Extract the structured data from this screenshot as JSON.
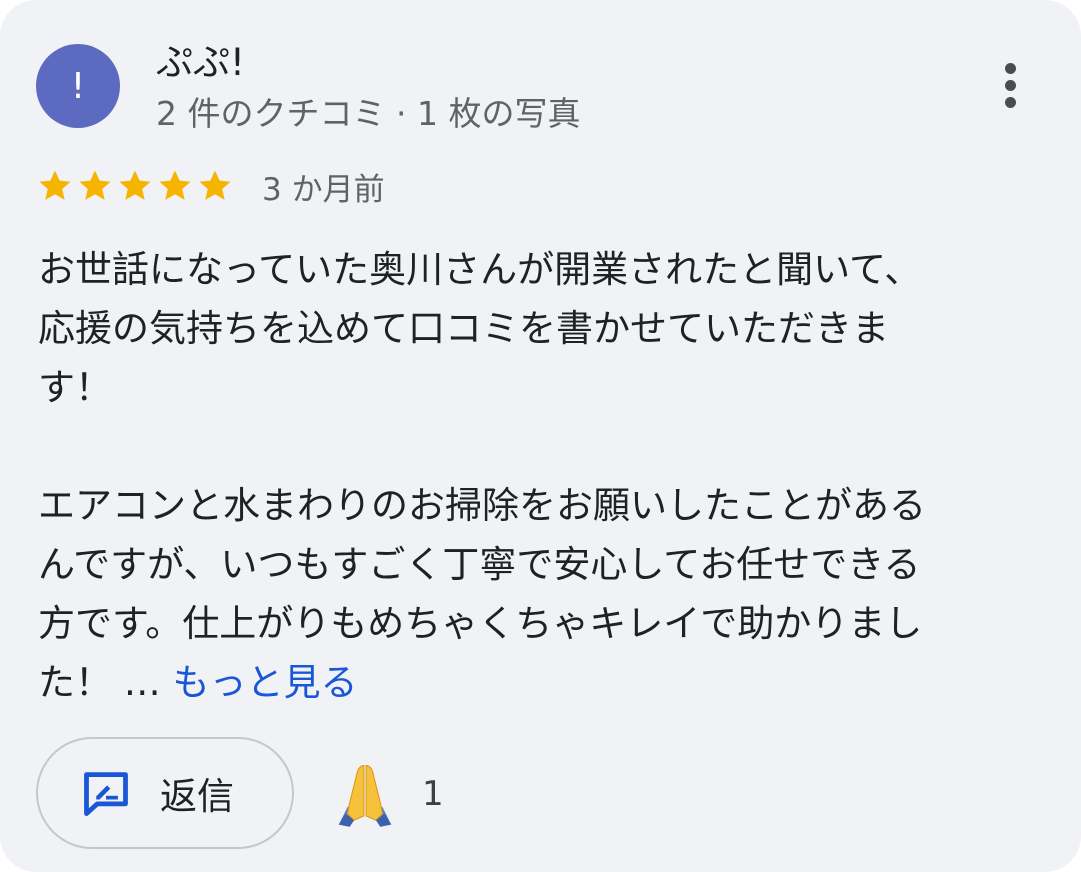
{
  "reviewer": {
    "avatar_initial": "!",
    "name": "ぷぷ!",
    "meta": "2 件のクチコミ · 1 枚の写真"
  },
  "menu": {
    "icon": "more-vert-icon"
  },
  "rating": {
    "stars": 5,
    "max_stars": 5,
    "star_color": "#f4b400",
    "date": "3 か月前"
  },
  "review": {
    "lines": [
      "お世話になっていた奥川さんが開業されたと聞いて、",
      "応援の気持ちを込めて口コミを書かせていただきま",
      "す！",
      "",
      "エアコンと水まわりのお掃除をお願いしたことがある",
      "んですが、いつもすごく丁寧で安心してお任せできる",
      "方です。仕上がりもめちゃくちゃキレイで助かりまし"
    ],
    "last_line_text": "た！ … ",
    "more_link": "もっと見る"
  },
  "actions": {
    "reply_label": "返信",
    "reply_icon": "rate-review-icon",
    "reaction_icon": "folded-hands-icon",
    "reaction_count": "1"
  },
  "colors": {
    "card_background": "#f1f2f5",
    "avatar": "#5c6bc0",
    "link": "#1a57d6",
    "reply_icon": "#1a57d6"
  }
}
